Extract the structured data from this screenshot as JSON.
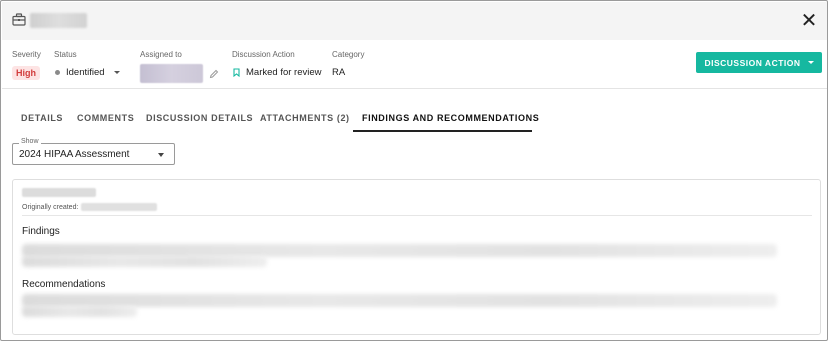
{
  "header": {
    "close_glyph": "✕"
  },
  "fields": {
    "severity": {
      "label": "Severity",
      "value": "High"
    },
    "status": {
      "label": "Status",
      "value": "Identified"
    },
    "assigned_to": {
      "label": "Assigned to"
    },
    "discussion_action": {
      "label": "Discussion Action",
      "value": "Marked for review"
    },
    "category": {
      "label": "Category",
      "value": "RA"
    }
  },
  "actions": {
    "discussion_action_button": "DISCUSSION ACTION"
  },
  "tabs": [
    {
      "label": "DETAILS",
      "active": false
    },
    {
      "label": "COMMENTS",
      "active": false
    },
    {
      "label": "DISCUSSION DETAILS",
      "active": false
    },
    {
      "label": "ATTACHMENTS (2)",
      "active": false
    },
    {
      "label": "FINDINGS AND RECOMMENDATIONS",
      "active": true
    }
  ],
  "filter": {
    "label": "Show",
    "value": "2024 HIPAA Assessment"
  },
  "card": {
    "created_label": "Originally created:",
    "findings_title": "Findings",
    "recommendations_title": "Recommendations"
  },
  "colors": {
    "accent": "#16b8a0",
    "severity_high_bg": "#fde4e4",
    "severity_high_text": "#d23c3c"
  },
  "icons": [
    "briefcase-icon",
    "close-icon",
    "pencil-icon",
    "bookmark-icon",
    "chevron-down-icon"
  ]
}
